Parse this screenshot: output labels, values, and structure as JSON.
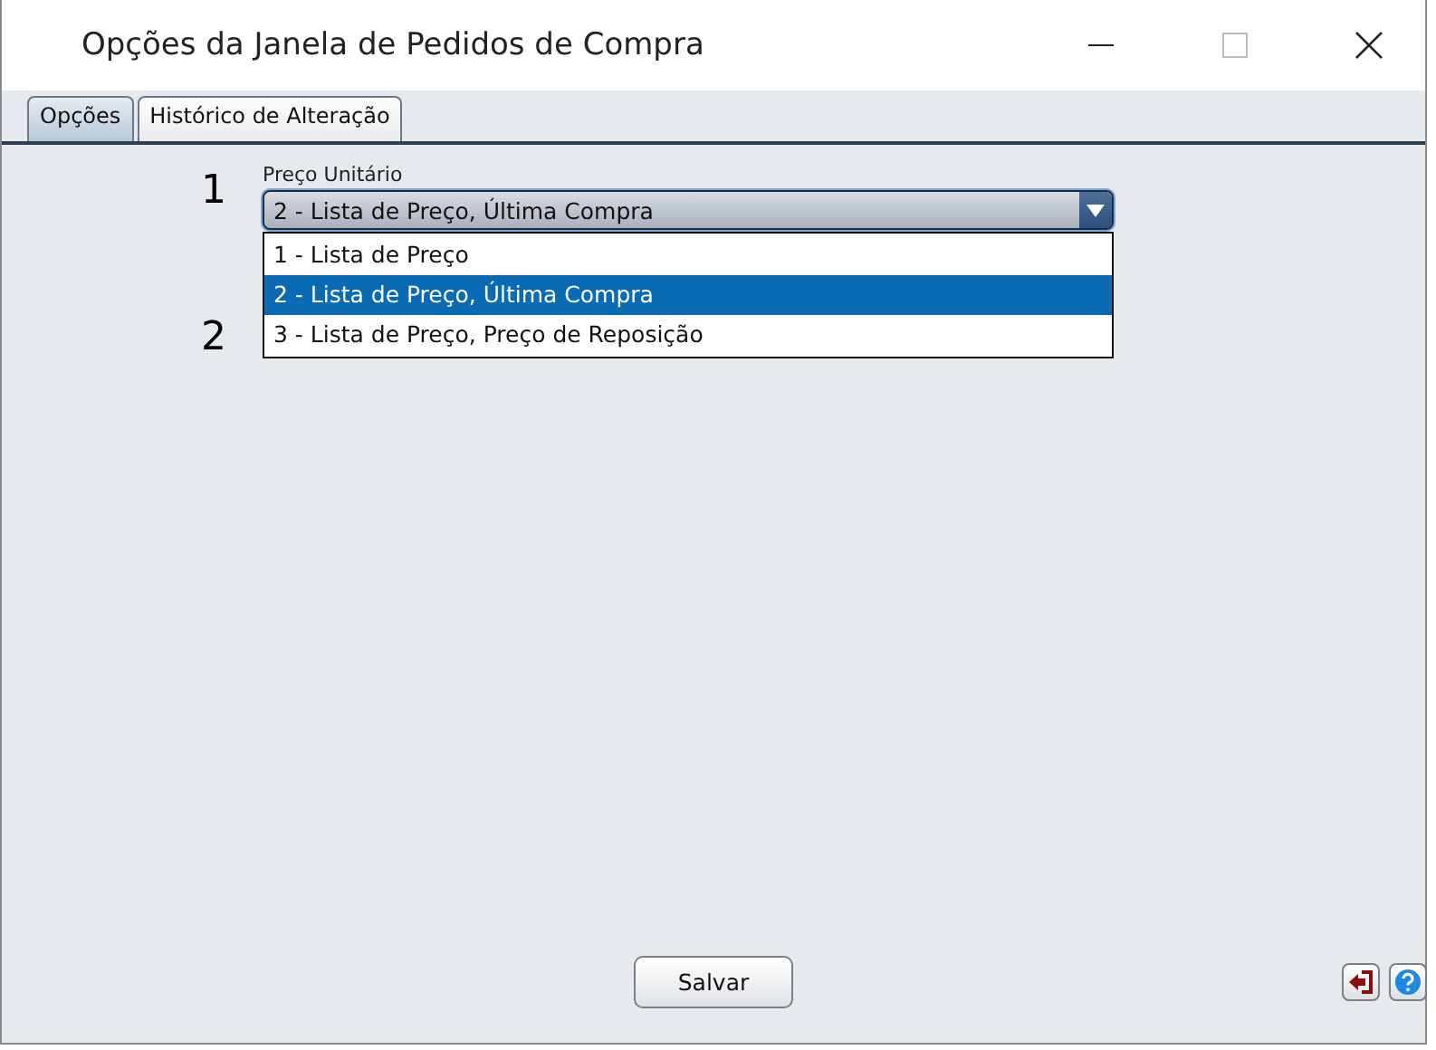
{
  "window": {
    "title": "Opções da Janela de Pedidos de Compra"
  },
  "tabs": [
    {
      "label": "Opções",
      "selected": true
    },
    {
      "label": "Histórico de Alteração",
      "selected": false
    }
  ],
  "fields": [
    {
      "number": "1",
      "label": "Preço Unitário",
      "value": "2 - Lista de Preço, Última Compra",
      "expanded": true,
      "options": [
        {
          "label": "1 - Lista de Preço",
          "selected": false
        },
        {
          "label": "2 - Lista de Preço, Última Compra",
          "selected": true
        },
        {
          "label": "3 - Lista de Preço, Preço de Reposição",
          "selected": false
        }
      ]
    },
    {
      "number": "2"
    }
  ],
  "buttons": [
    {
      "label": "Salvar"
    }
  ]
}
